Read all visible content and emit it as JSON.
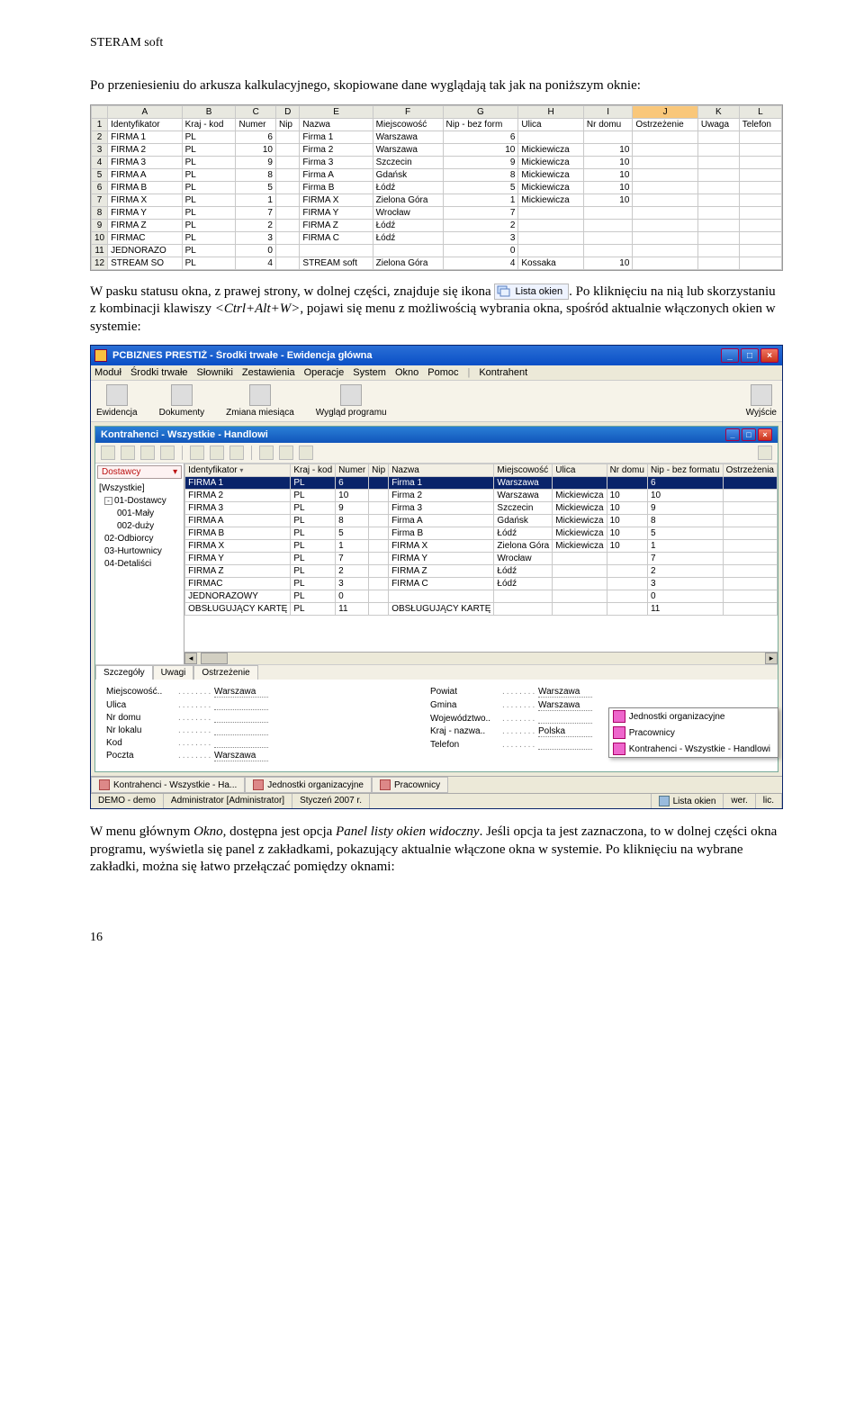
{
  "doc": {
    "header": "STERAM soft",
    "para1_a": "Po przeniesieniu do arkusza kalkulacyjnego, skopiowane dane wyglądają tak jak na poniższym oknie:",
    "para2_a": "W pasku statusu okna, z prawej strony, w dolnej części, znajduje się ikona ",
    "status_icon_label": "Lista okien",
    "para2_b": ". Po kliknięciu na nią lub skorzystaniu z kombinacji klawiszy ",
    "shortcut": "<Ctrl+Alt+W>",
    "para2_c": ", pojawi się menu z możliwością wybrania okna, spośród aktualnie włączonych okien w systemie:",
    "para3_a": "W menu głównym ",
    "para3_em1": "Okno",
    "para3_b": ", dostępna jest opcja ",
    "para3_em2": "Panel listy okien widoczny",
    "para3_c": ". Jeśli opcja ta jest zaznaczona, to w dolnej części okna programu, wyświetla się panel z zakładkami, pokazujący aktualnie włączone okna w systemie. Po kliknięciu na wybrane zakładki, można się łatwo przełączać pomiędzy oknami:",
    "pagenum": "16"
  },
  "sheet": {
    "cols": [
      "A",
      "B",
      "C",
      "D",
      "E",
      "F",
      "G",
      "H",
      "I",
      "J",
      "K",
      "L"
    ],
    "selected_col_index": 9,
    "headers_row": [
      "Identyfikator",
      "Kraj - kod",
      "Numer",
      "Nip",
      "Nazwa",
      "Miejscowość",
      "Nip - bez form",
      "Ulica",
      "Nr domu",
      "Ostrzeżenie",
      "Uwaga",
      "Telefon"
    ],
    "rows": [
      [
        "FIRMA 1",
        "PL",
        "6",
        "",
        "Firma 1",
        "Warszawa",
        "6",
        "",
        "",
        "",
        "",
        ""
      ],
      [
        "FIRMA 2",
        "PL",
        "10",
        "",
        "Firma 2",
        "Warszawa",
        "10",
        "Mickiewicza",
        "10",
        "",
        "",
        ""
      ],
      [
        "FIRMA 3",
        "PL",
        "9",
        "",
        "Firma 3",
        "Szczecin",
        "9",
        "Mickiewicza",
        "10",
        "",
        "",
        ""
      ],
      [
        "FIRMA A",
        "PL",
        "8",
        "",
        "Firma A",
        "Gdańsk",
        "8",
        "Mickiewicza",
        "10",
        "",
        "",
        ""
      ],
      [
        "FIRMA B",
        "PL",
        "5",
        "",
        "Firma B",
        "Łódź",
        "5",
        "Mickiewicza",
        "10",
        "",
        "",
        ""
      ],
      [
        "FIRMA X",
        "PL",
        "1",
        "",
        "FIRMA X",
        "Zielona Góra",
        "1",
        "Mickiewicza",
        "10",
        "",
        "",
        ""
      ],
      [
        "FIRMA Y",
        "PL",
        "7",
        "",
        "FIRMA Y",
        "Wrocław",
        "7",
        "",
        "",
        "",
        "",
        ""
      ],
      [
        "FIRMA Z",
        "PL",
        "2",
        "",
        "FIRMA Z",
        "Łódź",
        "2",
        "",
        "",
        "",
        "",
        ""
      ],
      [
        "FIRMAC",
        "PL",
        "3",
        "",
        "FIRMA C",
        "Łódź",
        "3",
        "",
        "",
        "",
        "",
        ""
      ],
      [
        "JEDNORAZO",
        "PL",
        "0",
        "",
        "",
        "",
        "0",
        "",
        "",
        "",
        "",
        ""
      ],
      [
        "STREAM SO",
        "PL",
        "4",
        "",
        "STREAM soft",
        "Zielona Góra",
        "4",
        "Kossaka",
        "10",
        "",
        "",
        ""
      ]
    ]
  },
  "app": {
    "title": "PCBIZNES PRESTIŻ - Środki trwałe - Ewidencja główna",
    "menus": [
      "Moduł",
      "Środki trwałe",
      "Słowniki",
      "Zestawienia",
      "Operacje",
      "System",
      "Okno",
      "Pomoc",
      "|",
      "Kontrahent"
    ],
    "toolbar": [
      {
        "label": "Ewidencja"
      },
      {
        "label": "Dokumenty"
      },
      {
        "label": "Zmiana miesiąca"
      },
      {
        "label": "Wygląd programu"
      }
    ],
    "toolbar_right": {
      "label": "Wyjście"
    },
    "subwin": {
      "title": "Kontrahenci - Wszystkie - Handlowi",
      "left": {
        "dropdown": "Dostawcy",
        "tree": [
          {
            "lvl": "root",
            "txt": "[Wszystkie]"
          },
          {
            "lvl": "lvl1",
            "sq": "-",
            "txt": "01-Dostawcy"
          },
          {
            "lvl": "lvl2",
            "txt": "001-Mały"
          },
          {
            "lvl": "lvl2",
            "txt": "002-duży"
          },
          {
            "lvl": "lvl1",
            "txt": "02-Odbiorcy"
          },
          {
            "lvl": "lvl1",
            "txt": "03-Hurtownicy"
          },
          {
            "lvl": "lvl1",
            "txt": "04-Detaliści"
          }
        ]
      },
      "grid": {
        "columns": [
          "Identyfikator",
          "Kraj - kod",
          "Numer",
          "Nip",
          "Nazwa",
          "Miejscowość",
          "Ulica",
          "Nr domu",
          "Nip - bez formatu",
          "Ostrzeżenia"
        ],
        "sort_col": 0,
        "rows": [
          {
            "sel": true,
            "c": [
              "FIRMA 1",
              "PL",
              "6",
              "",
              "Firma 1",
              "Warszawa",
              "",
              "",
              "6",
              ""
            ]
          },
          {
            "sel": false,
            "c": [
              "FIRMA 2",
              "PL",
              "10",
              "",
              "Firma 2",
              "Warszawa",
              "Mickiewicza",
              "10",
              "10",
              ""
            ]
          },
          {
            "sel": false,
            "c": [
              "FIRMA 3",
              "PL",
              "9",
              "",
              "Firma 3",
              "Szczecin",
              "Mickiewicza",
              "10",
              "9",
              ""
            ]
          },
          {
            "sel": false,
            "c": [
              "FIRMA A",
              "PL",
              "8",
              "",
              "Firma A",
              "Gdańsk",
              "Mickiewicza",
              "10",
              "8",
              ""
            ]
          },
          {
            "sel": false,
            "c": [
              "FIRMA B",
              "PL",
              "5",
              "",
              "Firma B",
              "Łódź",
              "Mickiewicza",
              "10",
              "5",
              ""
            ]
          },
          {
            "sel": false,
            "c": [
              "FIRMA X",
              "PL",
              "1",
              "",
              "FIRMA X",
              "Zielona Góra",
              "Mickiewicza",
              "10",
              "1",
              ""
            ]
          },
          {
            "sel": false,
            "c": [
              "FIRMA Y",
              "PL",
              "7",
              "",
              "FIRMA Y",
              "Wrocław",
              "",
              "",
              "7",
              ""
            ]
          },
          {
            "sel": false,
            "c": [
              "FIRMA Z",
              "PL",
              "2",
              "",
              "FIRMA Z",
              "Łódź",
              "",
              "",
              "2",
              ""
            ]
          },
          {
            "sel": false,
            "c": [
              "FIRMAC",
              "PL",
              "3",
              "",
              "FIRMA C",
              "Łódź",
              "",
              "",
              "3",
              ""
            ]
          },
          {
            "sel": false,
            "c": [
              "JEDNORAZOWY",
              "PL",
              "0",
              "",
              "",
              "",
              "",
              "",
              "0",
              ""
            ]
          },
          {
            "sel": false,
            "c": [
              "OBSŁUGUJĄCY KARTĘ",
              "PL",
              "11",
              "",
              "OBSŁUGUJĄCY KARTĘ",
              "",
              "",
              "",
              "11",
              ""
            ]
          }
        ]
      },
      "tabs": [
        "Szczegóły",
        "Uwagi",
        "Ostrzeżenie"
      ],
      "active_tab": 0,
      "details": {
        "left": [
          {
            "lbl": "Miejscowość..",
            "val": "Warszawa"
          },
          {
            "lbl": "Ulica",
            "val": ""
          },
          {
            "lbl": "Nr domu",
            "val": ""
          },
          {
            "lbl": "Nr lokalu",
            "val": ""
          },
          {
            "lbl": "Kod",
            "val": ""
          },
          {
            "lbl": "Poczta",
            "val": "Warszawa"
          }
        ],
        "right": [
          {
            "lbl": "Powiat",
            "val": "Warszawa"
          },
          {
            "lbl": "Gmina",
            "val": "Warszawa"
          },
          {
            "lbl": "Województwo..",
            "val": ""
          },
          {
            "lbl": "Kraj - nazwa..",
            "val": "Polska"
          },
          {
            "lbl": "Telefon",
            "val": ""
          }
        ]
      }
    },
    "popup_items": [
      "Jednostki organizacyjne",
      "Pracownicy",
      "Kontrahenci - Wszystkie - Handlowi"
    ],
    "taskbar": [
      "Kontrahenci - Wszystkie - Ha...",
      "Jednostki organizacyjne",
      "Pracownicy"
    ],
    "statusbar": {
      "c1": "DEMO - demo",
      "c2": "Administrator [Administrator]",
      "c3": "Styczeń 2007 r.",
      "c4": "Lista okien",
      "c5": "wer.",
      "c6": "lic."
    }
  }
}
